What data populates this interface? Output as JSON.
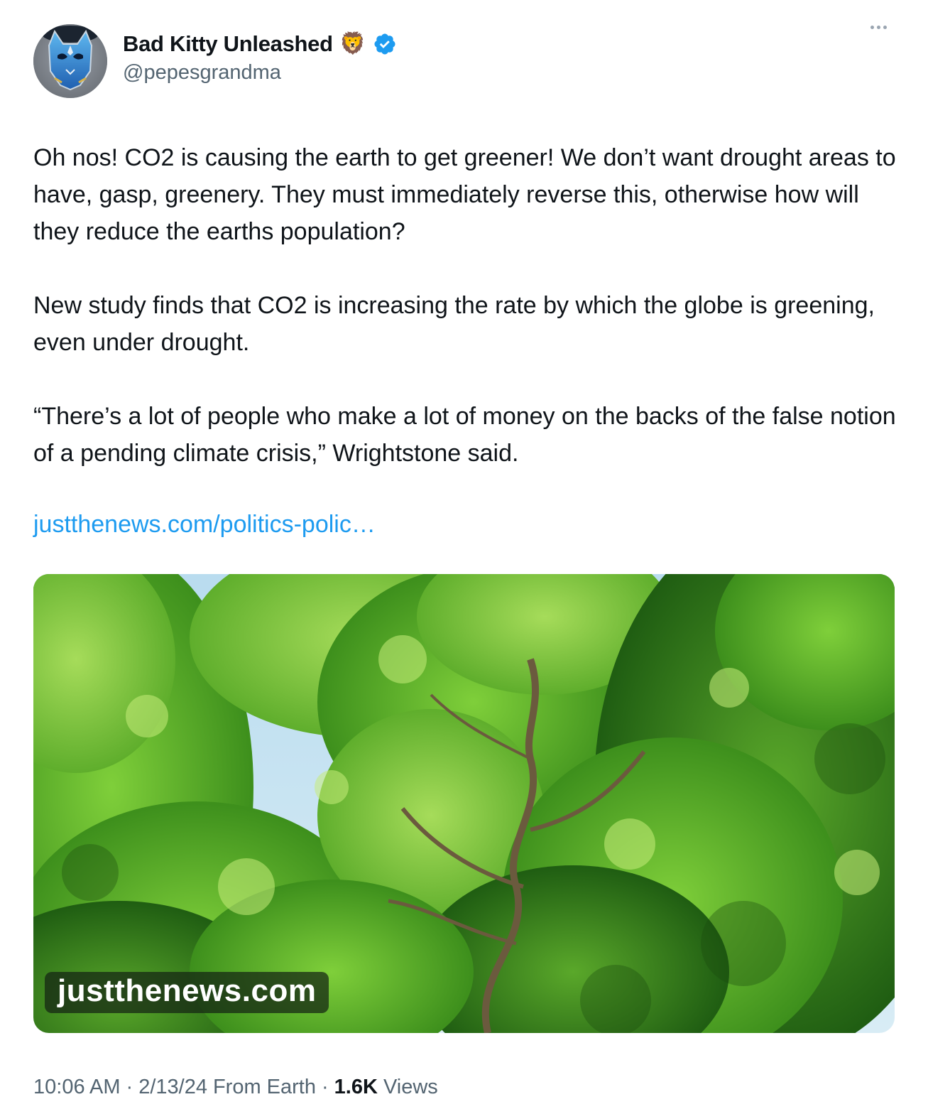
{
  "author": {
    "display_name": "Bad Kitty Unleashed",
    "name_emoji": "🦁",
    "handle": "@pepesgrandma",
    "avatar_icon": "blue-cat-mask-avatar",
    "verified_icon": "verified-badge-icon",
    "verified_color": "#1d9bf0"
  },
  "menu": {
    "icon": "more-options-icon"
  },
  "tweet": {
    "paragraphs": [
      "Oh nos! CO2 is causing the earth to get greener! We don’t want drought areas to have, gasp, greenery. They must immediately reverse this, otherwise how will they reduce the earths population?",
      "New study finds that CO2 is increasing the rate by which the globe is greening, even under drought.",
      "“There’s a lot of people who make a lot of money on the backs of the false notion of a pending climate crisis,” Wrightstone said."
    ],
    "link_text": "justthenews.com/politics-polic…",
    "link_color": "#1d9bf0"
  },
  "media": {
    "domain_label": "justthenews.com"
  },
  "footer": {
    "time": "10:06 AM",
    "separator": "·",
    "date": "2/13/24",
    "source": "From Earth",
    "views_count": "1.6K",
    "views_label": "Views"
  }
}
